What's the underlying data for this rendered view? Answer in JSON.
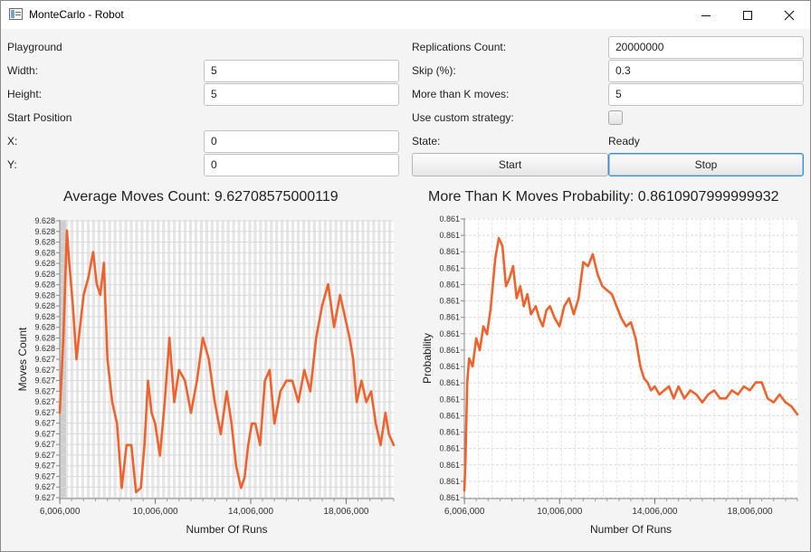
{
  "window": {
    "title": "MonteCarlo - Robot",
    "controls": [
      "minimize",
      "maximize",
      "close"
    ]
  },
  "form_left": {
    "playground_label": "Playground",
    "width_label": "Width:",
    "width_value": "5",
    "height_label": "Height:",
    "height_value": "5",
    "start_position_label": "Start Position",
    "x_label": "X:",
    "x_value": "0",
    "y_label": "Y:",
    "y_value": "0"
  },
  "form_right": {
    "replications_label": "Replications Count:",
    "replications_value": "20000000",
    "skip_label": "Skip (%):",
    "skip_value": "0.3",
    "k_moves_label": "More than K moves:",
    "k_moves_value": "5",
    "custom_strategy_label": "Use custom strategy:",
    "custom_strategy_checked": false,
    "state_label": "State:",
    "state_value": "Ready",
    "start_button": "Start",
    "stop_button": "Stop"
  },
  "colors": {
    "series": "#f0622d",
    "grid": "#e2e2e2",
    "plot_bg": "#ffffff"
  },
  "chart_data": [
    {
      "type": "line",
      "title": "Average Moves Count: 9.62708575000119",
      "xlabel": "Number Of Runs",
      "ylabel": "Moves Count",
      "xlim": [
        6000000,
        20000000
      ],
      "ylim": [
        9.62685,
        9.62815
      ],
      "x_ticks": [
        6006000,
        10006000,
        14006000,
        18006000
      ],
      "x_tick_labels": [
        "6,006,000",
        "10,006,000",
        "14,006,000",
        "18,006,000"
      ],
      "y_tick_labels": [
        "9.628",
        "9.628",
        "9.628",
        "9.628",
        "9.628",
        "9.628",
        "9.628",
        "9.628",
        "9.628",
        "9.628",
        "9.628",
        "9.628",
        "9.628",
        "9.627",
        "9.627",
        "9.627",
        "9.627",
        "9.627",
        "9.627",
        "9.627",
        "9.627",
        "9.627",
        "9.627",
        "9.627",
        "9.627",
        "9.627",
        "9.627"
      ],
      "grid": true,
      "series": [
        {
          "x": [
            6000000,
            6150000,
            6300000,
            6400000,
            6550000,
            6700000,
            6850000,
            7000000,
            7200000,
            7400000,
            7550000,
            7700000,
            7850000,
            8000000,
            8200000,
            8400000,
            8600000,
            8800000,
            9000000,
            9200000,
            9400000,
            9550000,
            9700000,
            9850000,
            10000000,
            10200000,
            10400000,
            10600000,
            10800000,
            11000000,
            11250000,
            11500000,
            11750000,
            12000000,
            12250000,
            12500000,
            12750000,
            13000000,
            13200000,
            13400000,
            13600000,
            13750000,
            13900000,
            14050000,
            14200000,
            14400000,
            14600000,
            14800000,
            15000000,
            15250000,
            15500000,
            15750000,
            16000000,
            16250000,
            16500000,
            16750000,
            17000000,
            17250000,
            17500000,
            17750000,
            17950000,
            18150000,
            18300000,
            18450000,
            18650000,
            18850000,
            19050000,
            19250000,
            19450000,
            19650000,
            19800000,
            20000000
          ],
          "y": [
            9.62725,
            9.6276,
            9.6281,
            9.62795,
            9.62775,
            9.6275,
            9.62765,
            9.6278,
            9.62788,
            9.628,
            9.62785,
            9.6278,
            9.62795,
            9.6275,
            9.6273,
            9.6272,
            9.6269,
            9.6271,
            9.6271,
            9.62688,
            9.6269,
            9.6271,
            9.6274,
            9.62725,
            9.6272,
            9.62705,
            9.6273,
            9.6276,
            9.6273,
            9.62745,
            9.6274,
            9.62725,
            9.6274,
            9.6276,
            9.6275,
            9.6273,
            9.62715,
            9.62735,
            9.6272,
            9.627,
            9.6269,
            9.62695,
            9.6271,
            9.6272,
            9.6272,
            9.6271,
            9.6274,
            9.62745,
            9.6272,
            9.62735,
            9.6274,
            9.6274,
            9.6273,
            9.62745,
            9.62735,
            9.6276,
            9.62775,
            9.62785,
            9.62765,
            9.6278,
            9.6277,
            9.6276,
            9.6275,
            9.6273,
            9.6274,
            9.6273,
            9.62735,
            9.6272,
            9.6271,
            9.62725,
            9.62715,
            9.6271
          ]
        }
      ]
    },
    {
      "type": "line",
      "title": "More Than K Moves Probability: 0.8610907999999932",
      "xlabel": "Number Of Runs",
      "ylabel": "Probability",
      "xlim": [
        6000000,
        20000000
      ],
      "ylim": [
        0.86085,
        0.86155
      ],
      "x_ticks": [
        6006000,
        10006000,
        14006000,
        18006000
      ],
      "x_tick_labels": [
        "6,006,000",
        "10,006,000",
        "14,006,000",
        "18,006,000"
      ],
      "y_tick_labels": [
        "0.861",
        "0.861",
        "0.861",
        "0.861",
        "0.861",
        "0.861",
        "0.861",
        "0.861",
        "0.861",
        "0.861",
        "0.861",
        "0.861",
        "0.861",
        "0.861",
        "0.861",
        "0.861",
        "0.861",
        "0.861"
      ],
      "grid": true,
      "series": [
        {
          "x": [
            6000000,
            6050000,
            6120000,
            6200000,
            6350000,
            6500000,
            6650000,
            6800000,
            6950000,
            7100000,
            7300000,
            7450000,
            7600000,
            7750000,
            7900000,
            8050000,
            8200000,
            8350000,
            8500000,
            8650000,
            8800000,
            9000000,
            9150000,
            9300000,
            9450000,
            9600000,
            9800000,
            10000000,
            10200000,
            10400000,
            10600000,
            10800000,
            11000000,
            11200000,
            11400000,
            11600000,
            11800000,
            12000000,
            12200000,
            12400000,
            12600000,
            12800000,
            13000000,
            13200000,
            13400000,
            13550000,
            13700000,
            13850000,
            14000000,
            14200000,
            14400000,
            14600000,
            14800000,
            15000000,
            15250000,
            15500000,
            15750000,
            16000000,
            16250000,
            16500000,
            16750000,
            17000000,
            17250000,
            17500000,
            17750000,
            18000000,
            18250000,
            18500000,
            18750000,
            19000000,
            19250000,
            19500000,
            19750000,
            20000000
          ],
          "y": [
            0.86087,
            0.86095,
            0.86114,
            0.8612,
            0.86118,
            0.86125,
            0.86122,
            0.86128,
            0.86126,
            0.86132,
            0.86145,
            0.8615,
            0.86148,
            0.86138,
            0.8614,
            0.86143,
            0.86135,
            0.86138,
            0.86133,
            0.86136,
            0.86131,
            0.86133,
            0.8613,
            0.86128,
            0.86132,
            0.86133,
            0.8613,
            0.86128,
            0.86133,
            0.86135,
            0.86131,
            0.86135,
            0.86144,
            0.86143,
            0.86146,
            0.86141,
            0.86138,
            0.86137,
            0.86136,
            0.86133,
            0.8613,
            0.86128,
            0.86129,
            0.86125,
            0.86118,
            0.86115,
            0.86114,
            0.86112,
            0.86113,
            0.86111,
            0.86112,
            0.86113,
            0.8611,
            0.86113,
            0.8611,
            0.86112,
            0.86111,
            0.86109,
            0.86111,
            0.86112,
            0.8611,
            0.8611,
            0.86112,
            0.86111,
            0.86113,
            0.86112,
            0.86114,
            0.86114,
            0.8611,
            0.86109,
            0.86111,
            0.86109,
            0.86108,
            0.86106
          ]
        }
      ]
    }
  ]
}
